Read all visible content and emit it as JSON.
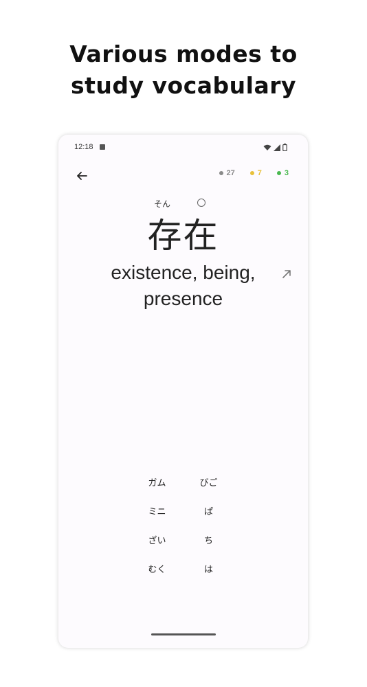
{
  "promo": {
    "headline_line1": "Various modes to",
    "headline_line2": "study vocabulary"
  },
  "status_bar": {
    "time": "12:18",
    "icons": [
      "notification-a-icon",
      "wifi-icon",
      "signal-icon",
      "battery-icon"
    ]
  },
  "header": {
    "back_icon": "arrow-left-icon",
    "counters": [
      {
        "value": "27",
        "color": "#8a8a8a"
      },
      {
        "value": "7",
        "color": "#e8c13a"
      },
      {
        "value": "3",
        "color": "#49b84f"
      }
    ]
  },
  "card": {
    "reading": "そん",
    "word": "存在",
    "meaning": "existence, being, presence",
    "open_icon": "arrow-up-right-icon"
  },
  "options": [
    {
      "label": "ガム"
    },
    {
      "label": "びご"
    },
    {
      "label": "ミニ"
    },
    {
      "label": "ぱ"
    },
    {
      "label": "ざい"
    },
    {
      "label": "ち"
    },
    {
      "label": "むく"
    },
    {
      "label": "は"
    }
  ]
}
